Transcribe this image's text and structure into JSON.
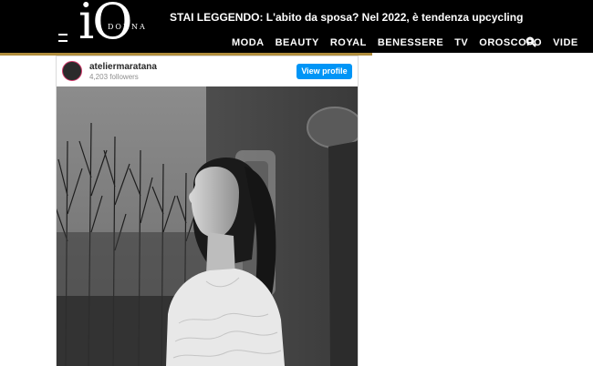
{
  "header": {
    "logo_main": "iO",
    "logo_sub": "DONNA",
    "reading_label": "STAI LEGGENDO:",
    "reading_title": "L'abito da sposa? Nel 2022, è tendenza upcycling",
    "nav": [
      "MODA",
      "BEAUTY",
      "ROYAL",
      "BENESSERE",
      "TV",
      "OROSCOPO",
      "VIDE"
    ]
  },
  "embed": {
    "username": "ateliermaratana",
    "followers": "4,203 followers",
    "view_profile": "View profile"
  },
  "colors": {
    "header_bg": "#000000",
    "accent_gold": "#b08d3c",
    "button_blue": "#0095f6"
  },
  "icons": [
    "menu-icon",
    "search-icon",
    "avatar"
  ]
}
